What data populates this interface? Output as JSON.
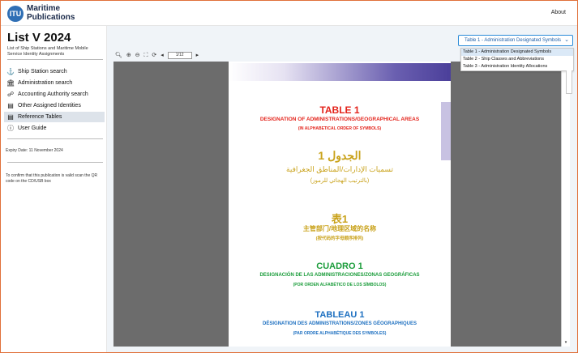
{
  "header": {
    "logo_line1": "Maritime",
    "logo_line2": "Publications",
    "logo_mark": "ITU",
    "about_label": "About"
  },
  "sidebar": {
    "title": "List V 2024",
    "subtitle": "List of Ship Stations and Maritime Mobile Service Identity Assignments",
    "items": [
      {
        "label": "Ship Station search",
        "icon": "ship-icon",
        "glyph": "⚓"
      },
      {
        "label": "Administration search",
        "icon": "building-icon",
        "glyph": "🏛"
      },
      {
        "label": "Accounting Authority search",
        "icon": "broadcast-icon",
        "glyph": "☍"
      },
      {
        "label": "Other Assigned Identities",
        "icon": "document-icon",
        "glyph": "▤"
      },
      {
        "label": "Reference Tables",
        "icon": "document-icon",
        "glyph": "▤"
      },
      {
        "label": "User Guide",
        "icon": "info-icon",
        "glyph": "ⓘ"
      }
    ],
    "expiry": "Expiry Date: 11 November 2024",
    "scan_note": "To confirm that this publication is valid scan the QR code on the CD/USB box"
  },
  "toolbar": {
    "page_indicator": "1/12",
    "icons": [
      "search-icon",
      "zoom-in-icon",
      "zoom-out-icon",
      "fit-page-icon",
      "rotate-icon",
      "prev-page-icon",
      "next-page-icon"
    ]
  },
  "table_select": {
    "selected": "Table 1 - Administration Designated Symbols",
    "options": [
      "Table 1 - Administration Designated Symbols",
      "Table 2 - Ship Classes and Abbreviations",
      "Table 3 - Administration Identity Allocations"
    ]
  },
  "document": {
    "en_title": "TABLE 1",
    "en_sub1": "DESIGNATION OF ADMINISTRATIONS/GEOGRAPHICAL AREAS",
    "en_sub2": "(IN ALPHABETICAL ORDER OF SYMBOLS)",
    "ar_title": "الجدول 1",
    "ar_sub1": "تسميات الإدارات/المناطق الجغرافية",
    "ar_sub2": "(بالترتيب الهجائي للرموز)",
    "zh_title": "表1",
    "zh_sub1": "主管部门/地理区域的名称",
    "zh_sub2": "(按代码的字母顺序排列)",
    "es_title": "CUADRO 1",
    "es_sub1": "DESIGNACIÓN DE LAS ADMINISTRACIONES/ZONAS GEOGRÁFICAS",
    "es_sub2": "(POR ORDEN ALFABÉTICO DE LOS SÍMBOLOS)",
    "fr_title": "TABLEAU 1",
    "fr_sub1": "DÉSIGNATION DES ADMINISTRATIONS/ZONES GÉOGRAPHIQUES",
    "fr_sub2": "(PAR ORDRE ALPHABÉTIQUE DES SYMBOLES)"
  },
  "colors": {
    "accent": "#2a8bd8",
    "red": "#e3231b",
    "gold": "#c9a21a",
    "green": "#1a9c3a",
    "blue": "#1c6fc0"
  }
}
